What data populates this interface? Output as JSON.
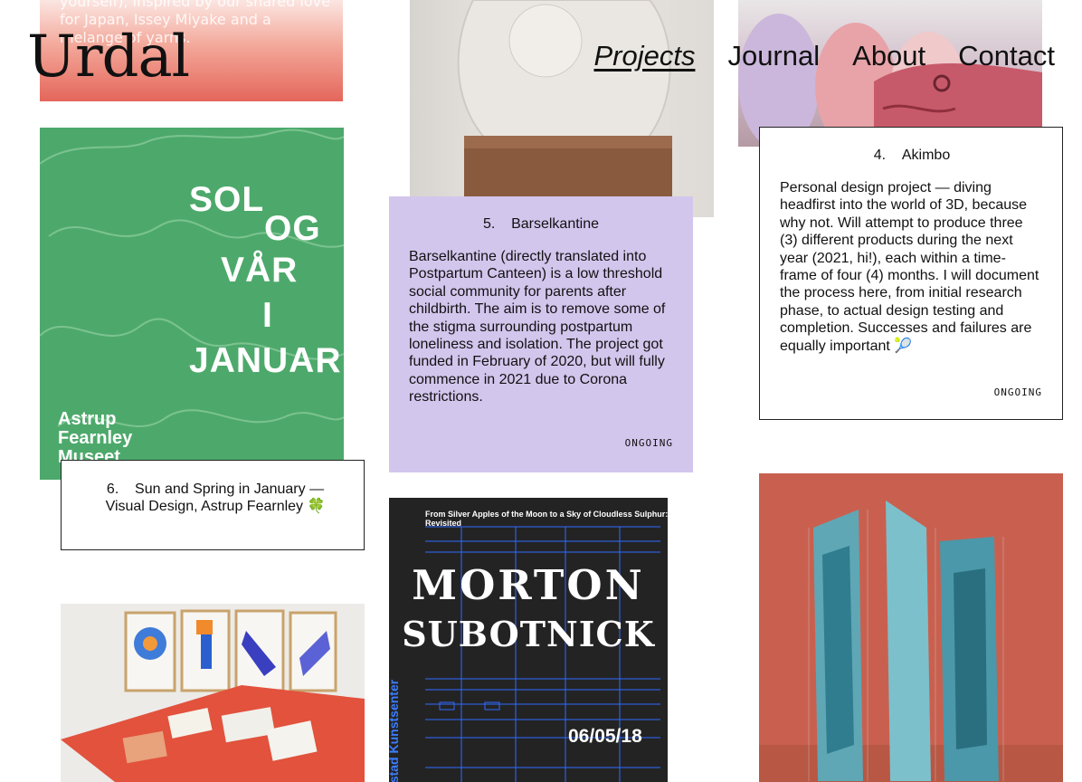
{
  "site": {
    "logo": "Urdal"
  },
  "nav": {
    "items": [
      {
        "label": "Projects",
        "active": true
      },
      {
        "label": "Journal",
        "active": false
      },
      {
        "label": "About",
        "active": false
      },
      {
        "label": "Contact",
        "active": false
      }
    ]
  },
  "fragments": {
    "red_card_text": "yourself), inspired by our shared love for Japan, Issey Miyake and a melange of yarns."
  },
  "poster_green": {
    "lines": [
      "SOL",
      "OG",
      "VÅR",
      "I",
      "JANUAR"
    ],
    "museum": [
      "Astrup",
      "Fearnley",
      "Museet"
    ]
  },
  "cards": {
    "barselkantine": {
      "number": "5.",
      "title": "Barselkantine",
      "description": "Barselkantine (directly translated into Postpartum Canteen) is a low threshold social community for parents after childbirth. The aim is to remove some of the stigma surrounding postpartum loneliness and isolation. The project got funded in February of 2020, but will fully commence in 2021 due to Corona restrictions.",
      "status": "ONGOING",
      "color": "#d3c6ed"
    },
    "akimbo": {
      "number": "4.",
      "title": "Akimbo",
      "description": "Personal design project — diving headfirst into the world of 3D, because why not. Will attempt to produce three (3) different products during the next year (2021, hi!), each within a time-frame of four (4) months. I will document the process here, from initial research phase, to actual design testing and completion. Successes and failures are equally important 🎾",
      "status": "ONGOING"
    },
    "sun_spring": {
      "number": "6.",
      "title": "Sun and Spring in January — Visual Design, Astrup Fearnley 🍀"
    }
  },
  "poster_morton": {
    "subtitle": "From Silver Apples of the Moon to a Sky of Cloudless Sulphur: Revisited",
    "line1": "MORTON",
    "line2": "SUBOTNICK",
    "date": "06/05/18",
    "venue": "stad Kunstsenter",
    "accent": "#3b7dff"
  }
}
